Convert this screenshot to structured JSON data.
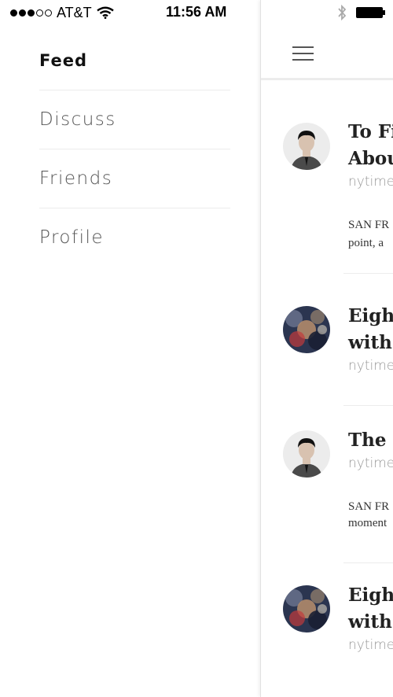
{
  "status_bar": {
    "carrier": "AT&T",
    "time": "11:56 AM",
    "signal_bars_filled": 3,
    "signal_bars_total": 5
  },
  "drawer": {
    "menu": [
      {
        "label": "Feed",
        "active": true
      },
      {
        "label": "Discuss",
        "active": false
      },
      {
        "label": "Friends",
        "active": false
      },
      {
        "label": "Profile",
        "active": false
      }
    ]
  },
  "feed": {
    "cards": [
      {
        "avatar": "person-avatar",
        "title_lines": [
          "To Fi",
          "Abou"
        ],
        "source": "nytimes",
        "excerpt_lines": [
          "SAN FR",
          "point, a"
        ]
      },
      {
        "avatar": "blurred-avatar",
        "title_lines": [
          "Eigh",
          "with"
        ],
        "source": "nytimes",
        "excerpt_lines": []
      },
      {
        "avatar": "person-avatar",
        "title_lines": [
          "The"
        ],
        "source": "nytimes",
        "excerpt_lines": [
          "SAN FR",
          "moment"
        ]
      },
      {
        "avatar": "blurred-avatar",
        "title_lines": [
          "Eigh",
          "with"
        ],
        "source": "nytimes",
        "excerpt_lines": []
      }
    ]
  },
  "colors": {
    "background": "#ffffff",
    "divider": "#ececec",
    "text_primary": "#222222",
    "text_secondary": "#9a9a9a"
  }
}
